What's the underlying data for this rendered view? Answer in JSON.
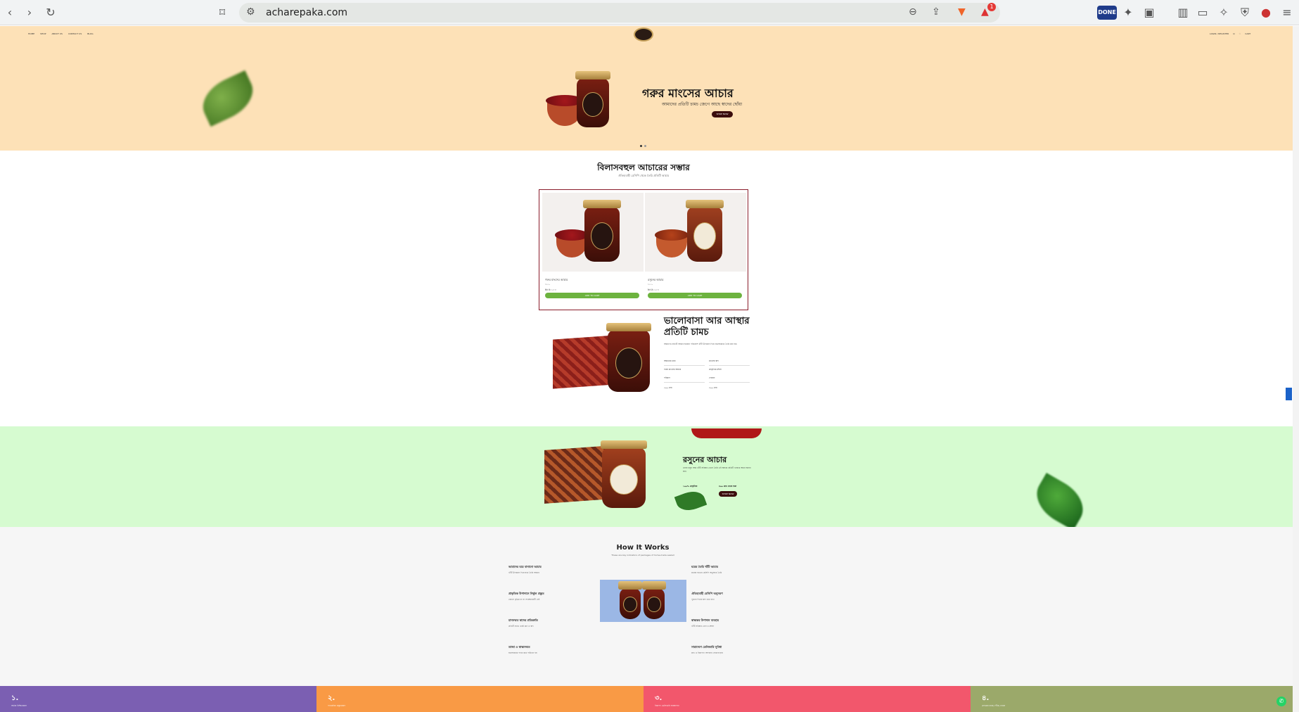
{
  "browser": {
    "url": "acharepaka.com",
    "ext_badge": "1",
    "done_label": "DONE"
  },
  "nav": {
    "links": [
      "HOME",
      "SHOP",
      "ABOUT US",
      "CONTACT US",
      "BLOG"
    ],
    "right": [
      "LOGIN / REGISTER",
      "Q",
      "♡",
      "CART"
    ]
  },
  "hero": {
    "title": "গরুর মাংসের আচার",
    "subtitle": "আমাদের প্রতিটি চামচ জেগে আছে স্বাদের ছোঁয়া",
    "button": "SHOP NOW"
  },
  "collection": {
    "title": "বিলাসবহুল আচারের সম্ভার",
    "subtitle": "ঐতিহ্যবাহী রেসিপি থেকে তৈরি প্রতিটি আচার",
    "products": [
      {
        "name": "গরুর মাংসের আচার",
        "old_price": "৳৯৫০",
        "price": "৳৮৫০.০০",
        "button": "ADD TO CART"
      },
      {
        "name": "রসুনের আচার",
        "old_price": "৳৫৫০",
        "price": "৳৪৫০.০০",
        "button": "ADD TO CART"
      }
    ]
  },
  "feature": {
    "title": "ভালোবাসা আর আস্থার প্রতিটি চামচ",
    "desc": "আমাদের প্রতিটি আচার ঘরোয়া পরিবেশে খাঁটি উপকরণ দিয়ে যত্নসহকারে তৈরি করা হয়।",
    "rows": [
      [
        "আচারের ধরন",
        "মাংসের স্বাদ"
      ],
      [
        "গরুর মাংসের আচার",
        "প্রাকৃতিক মশলা"
      ],
      [
        "পরিমাণ",
        "দোকান"
      ],
      [
        "৫০০ গ্রাম",
        "৩০০ গ্রাম"
      ]
    ],
    "button": "SHOP NOW"
  },
  "garlic": {
    "title": "রসুনের আচার",
    "desc": "তাজা রসুন আর খাঁটি সরিষার তেলে তৈরি এই আচার প্রতিটি খাবারে আনে অনন্য স্বাদ।",
    "meta_left": "১০০% প্রাকৃতিক",
    "meta_right": "৪০০ গ্রাম থেকে শুরু",
    "button": "SHOP NOW"
  },
  "how": {
    "title": "How It Works",
    "subtitle": "These are key indicators of packages of home-made sealed",
    "left_steps": [
      {
        "t": "আমাদের ঘরে বানানো আচার",
        "d": "খাঁটি উপকরণ দিয়ে ঘরে তৈরি আচার"
      },
      {
        "t": "প্রাকৃতিক উপাদানে নির্ভুল প্রস্তুত",
        "d": "কোনো কৃত্রিম রং বা সংরক্ষণকারী নেই"
      },
      {
        "t": "মানসম্মত স্বাদের প্রতিশ্রুতি",
        "d": "প্রতিটি ব্যাচে একই মান ও স্বাদ"
      },
      {
        "t": "তাজা ও স্বাস্থ্যসম্মত",
        "d": "যত্নসহকারে প্যাক করে পাঠানো হয়"
      }
    ],
    "right_steps": [
      {
        "t": "ঘরের তৈরি খাঁটি আচার",
        "d": "মায়ের হাতের রেসিপি অনুসারে তৈরি"
      },
      {
        "t": "ঐতিহ্যবাহী রেসিপি অনুসরণ",
        "d": "পুরনো দিনের স্বাদ ধরে রাখা"
      },
      {
        "t": "স্বাস্থ্যকর উপাদান ব্যবহার",
        "d": "খাঁটি সরিষার তেল ও মশলা"
      },
      {
        "t": "সারাদেশে ডেলিভারি সুবিধা",
        "d": "দ্রুত ও নিরাপদে আপনার দোরগোড়ায়"
      }
    ]
  },
  "bands": [
    {
      "n": "১.",
      "s": "অর্ডার নিশ্চিতকরণ",
      "color": "#7b5fb2"
    },
    {
      "n": "২.",
      "s": "প্যাকেজিং প্রস্তুতকরণ",
      "color": "#f99a45"
    },
    {
      "n": "৩.",
      "s": "নিরাপদ ডেলিভারি ব্যবস্থাপনা",
      "color": "#f2576c"
    },
    {
      "n": "৪.",
      "s": "গ্রাহকের কাছে পৌঁছে দেওয়া",
      "color": "#9ba96a"
    }
  ]
}
